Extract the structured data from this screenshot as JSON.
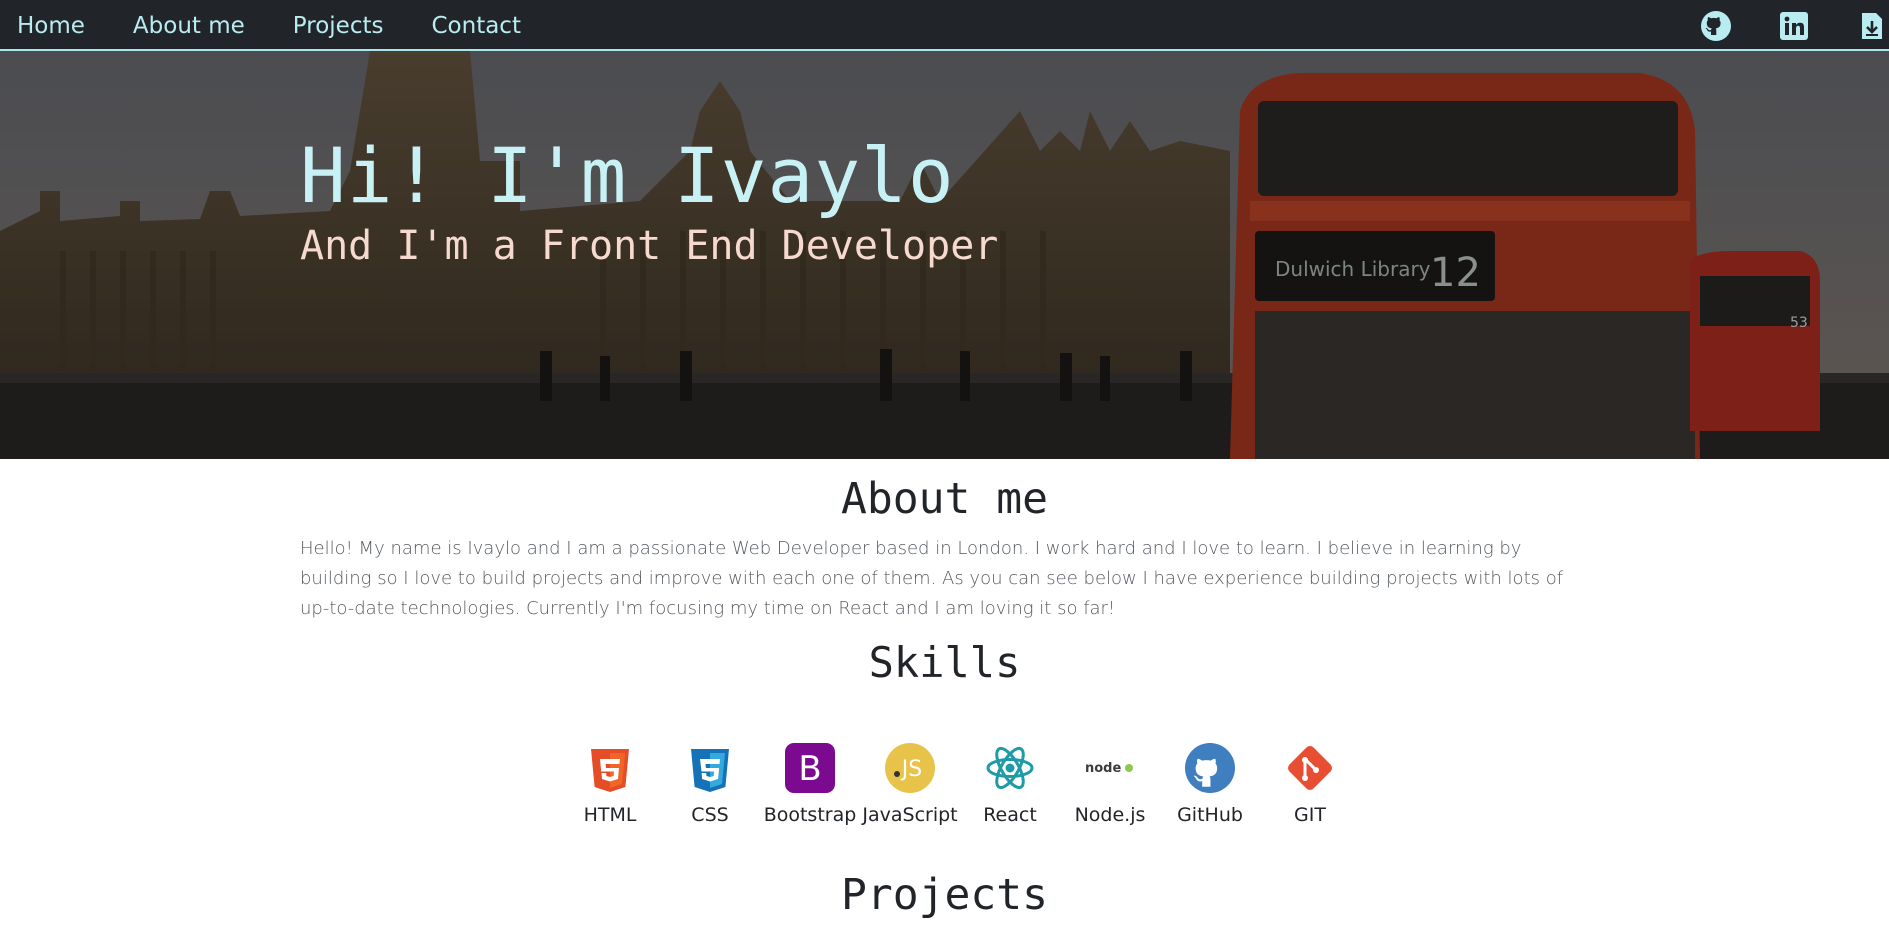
{
  "nav": {
    "links": [
      "Home",
      "About me",
      "Projects",
      "Contact"
    ],
    "icons": [
      "github-icon",
      "linkedin-icon",
      "download-cv-icon"
    ]
  },
  "hero": {
    "title": "Hi! I'm Ivaylo",
    "subtitle": "And I'm a Front End Developer",
    "bus_sign": "Dulwich Library",
    "bus_number": "12",
    "bus2_number": "53"
  },
  "about": {
    "heading": "About me",
    "text": "Hello! My name is Ivaylo and I am a passionate Web Developer based in London. I work hard and I love to learn. I believe in learning by building so I love to build projects and improve with each one of them. As you can see below I have experience building projects with lots of up-to-date technologies. Currently I'm focusing my time on React and I am loving it so far!"
  },
  "skills": {
    "heading": "Skills",
    "items": [
      {
        "label": "HTML",
        "icon": "html5-icon",
        "color": "#e44d26"
      },
      {
        "label": "CSS",
        "icon": "css3-icon",
        "color": "#1572b6"
      },
      {
        "label": "Bootstrap",
        "icon": "bootstrap-icon",
        "color": "#7b0a91"
      },
      {
        "label": "JavaScript",
        "icon": "javascript-icon",
        "color": "#e8c34a"
      },
      {
        "label": "React",
        "icon": "react-icon",
        "color": "#1e9ba8"
      },
      {
        "label": "Node.js",
        "icon": "nodejs-icon",
        "color": "#3c3c3c"
      },
      {
        "label": "GitHub",
        "icon": "github-icon",
        "color": "#3f7fbf"
      },
      {
        "label": "GIT",
        "icon": "git-icon",
        "color": "#e84e31"
      }
    ]
  },
  "projects": {
    "heading": "Projects"
  },
  "colors": {
    "navbar_bg": "#212529",
    "nav_link": "#b9ecf1",
    "hero_title": "#c8f1f6",
    "hero_subtitle": "#f6d9cf"
  }
}
